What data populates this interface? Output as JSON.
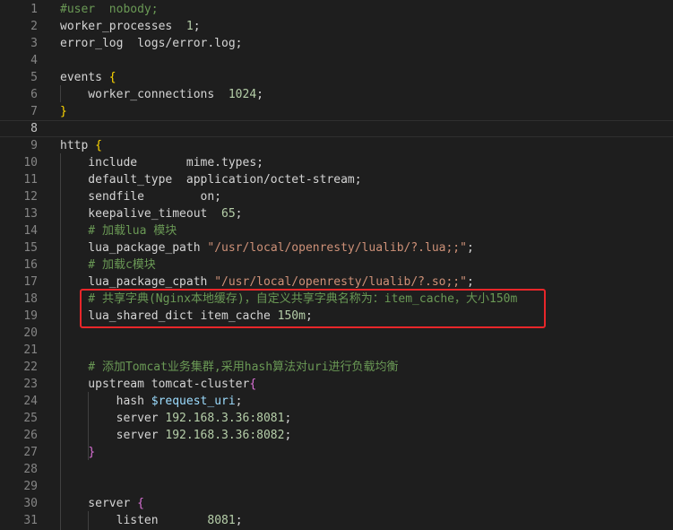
{
  "editor": {
    "highlight_color": "#e8262a",
    "lines": [
      {
        "n": "1",
        "tokens": [
          {
            "t": "#user  nobody;",
            "c": "tk-comment"
          }
        ]
      },
      {
        "n": "2",
        "tokens": [
          {
            "t": "worker_processes  ",
            "c": "tk-key"
          },
          {
            "t": "1",
            "c": "tk-num"
          },
          {
            "t": ";",
            "c": "tk-punct"
          }
        ]
      },
      {
        "n": "3",
        "tokens": [
          {
            "t": "error_log  logs/error.log;",
            "c": "tk-key"
          }
        ]
      },
      {
        "n": "4",
        "tokens": []
      },
      {
        "n": "5",
        "tokens": [
          {
            "t": "events ",
            "c": "tk-key"
          },
          {
            "t": "{",
            "c": "tk-brace"
          }
        ]
      },
      {
        "n": "6",
        "tokens": [
          {
            "t": "    worker_connections  ",
            "c": "tk-key"
          },
          {
            "t": "1024",
            "c": "tk-num"
          },
          {
            "t": ";",
            "c": "tk-punct"
          }
        ]
      },
      {
        "n": "7",
        "tokens": [
          {
            "t": "}",
            "c": "tk-brace"
          }
        ]
      },
      {
        "n": "8",
        "tokens": [],
        "current": true
      },
      {
        "n": "9",
        "tokens": [
          {
            "t": "http ",
            "c": "tk-key"
          },
          {
            "t": "{",
            "c": "tk-brace"
          }
        ]
      },
      {
        "n": "10",
        "tokens": [
          {
            "t": "    include       mime.types;",
            "c": "tk-key"
          }
        ]
      },
      {
        "n": "11",
        "tokens": [
          {
            "t": "    default_type  application/octet-stream;",
            "c": "tk-key"
          }
        ]
      },
      {
        "n": "12",
        "tokens": [
          {
            "t": "    sendfile        on;",
            "c": "tk-key"
          }
        ]
      },
      {
        "n": "13",
        "tokens": [
          {
            "t": "    keepalive_timeout  ",
            "c": "tk-key"
          },
          {
            "t": "65",
            "c": "tk-num"
          },
          {
            "t": ";",
            "c": "tk-punct"
          }
        ]
      },
      {
        "n": "14",
        "tokens": [
          {
            "t": "    # 加载lua 模块",
            "c": "tk-comment"
          }
        ]
      },
      {
        "n": "15",
        "tokens": [
          {
            "t": "    lua_package_path ",
            "c": "tk-key"
          },
          {
            "t": "\"/usr/local/openresty/lualib/?.lua;;\"",
            "c": "tk-str"
          },
          {
            "t": ";",
            "c": "tk-punct"
          }
        ]
      },
      {
        "n": "16",
        "tokens": [
          {
            "t": "    # 加载c模块",
            "c": "tk-comment"
          }
        ]
      },
      {
        "n": "17",
        "tokens": [
          {
            "t": "    lua_package_cpath ",
            "c": "tk-key"
          },
          {
            "t": "\"/usr/local/openresty/lualib/?.so;;\"",
            "c": "tk-str"
          },
          {
            "t": ";",
            "c": "tk-punct"
          }
        ]
      },
      {
        "n": "18",
        "tokens": [
          {
            "t": "    # 共享字典(Nginx本地缓存)，自定义共享字典名称为：item_cache，大小150m",
            "c": "tk-comment"
          }
        ]
      },
      {
        "n": "19",
        "tokens": [
          {
            "t": "    lua_shared_dict item_cache ",
            "c": "tk-key"
          },
          {
            "t": "150m",
            "c": "tk-num"
          },
          {
            "t": ";",
            "c": "tk-punct"
          }
        ]
      },
      {
        "n": "20",
        "tokens": []
      },
      {
        "n": "21",
        "tokens": []
      },
      {
        "n": "22",
        "tokens": [
          {
            "t": "    # 添加Tomcat业务集群,采用hash算法对uri进行负载均衡",
            "c": "tk-comment"
          }
        ]
      },
      {
        "n": "23",
        "tokens": [
          {
            "t": "    upstream tomcat-cluster",
            "c": "tk-key"
          },
          {
            "t": "{",
            "c": "tk-brace2"
          }
        ]
      },
      {
        "n": "24",
        "tokens": [
          {
            "t": "        hash ",
            "c": "tk-key"
          },
          {
            "t": "$request_uri",
            "c": "tk-var"
          },
          {
            "t": ";",
            "c": "tk-punct"
          }
        ]
      },
      {
        "n": "25",
        "tokens": [
          {
            "t": "        server ",
            "c": "tk-key"
          },
          {
            "t": "192.168.3.36:8081",
            "c": "tk-num"
          },
          {
            "t": ";",
            "c": "tk-punct"
          }
        ]
      },
      {
        "n": "26",
        "tokens": [
          {
            "t": "        server ",
            "c": "tk-key"
          },
          {
            "t": "192.168.3.36:8082",
            "c": "tk-num"
          },
          {
            "t": ";",
            "c": "tk-punct"
          }
        ]
      },
      {
        "n": "27",
        "tokens": [
          {
            "t": "    ",
            "c": "tk-key"
          },
          {
            "t": "}",
            "c": "tk-brace2"
          }
        ]
      },
      {
        "n": "28",
        "tokens": []
      },
      {
        "n": "29",
        "tokens": []
      },
      {
        "n": "30",
        "tokens": [
          {
            "t": "    server ",
            "c": "tk-key"
          },
          {
            "t": "{",
            "c": "tk-brace2"
          }
        ]
      },
      {
        "n": "31",
        "tokens": [
          {
            "t": "        listen       ",
            "c": "tk-key"
          },
          {
            "t": "8081",
            "c": "tk-num"
          },
          {
            "t": ";",
            "c": "tk-punct"
          }
        ]
      }
    ]
  }
}
